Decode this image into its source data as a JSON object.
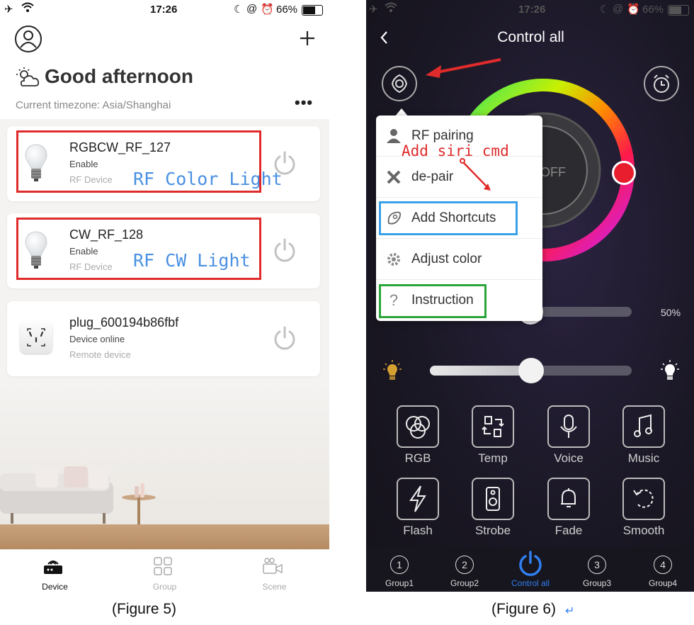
{
  "left": {
    "status": {
      "time": "17:26",
      "battery": "66%"
    },
    "greeting": "Good afternoon",
    "timezone": "Current timezone: Asia/Shanghai",
    "devices": [
      {
        "name": "RGBCW_RF_127",
        "line1": "Enable",
        "line2": "RF Device",
        "tag": "RF Color Light"
      },
      {
        "name": "CW_RF_128",
        "line1": "Enable",
        "line2": "RF Device",
        "tag": "RF CW Light"
      },
      {
        "name": "plug_600194b86fbf",
        "line1": "Device online",
        "line2": "Remote device"
      }
    ],
    "tabs": [
      "Device",
      "Group",
      "Scene"
    ],
    "caption": "(Figure 5)"
  },
  "right": {
    "status": {
      "time": "17:26",
      "battery": "66%"
    },
    "title": "Control all",
    "menu": [
      "RF pairing",
      "de-pair",
      "Add Shortcuts",
      "Adjust color",
      "Instruction"
    ],
    "annotation": "Add siri cmd",
    "off_label": "OFF",
    "percent": "50%",
    "brightness_level": 0.5,
    "temp_level": 0.5,
    "controls_row1": [
      "RGB",
      "Temp",
      "Voice",
      "Music"
    ],
    "controls_row2": [
      "Flash",
      "Strobe",
      "Fade",
      "Smooth"
    ],
    "groups": [
      "Group1",
      "Group2",
      "Control all",
      "Group3",
      "Group4"
    ],
    "group_numbers": [
      "1",
      "2",
      "3",
      "4"
    ],
    "caption": "(Figure 6)",
    "colors": {
      "accent": "#2f7ff0",
      "red": "#e02b2b",
      "blue": "#3aa0e8",
      "green": "#2aa63a"
    }
  }
}
